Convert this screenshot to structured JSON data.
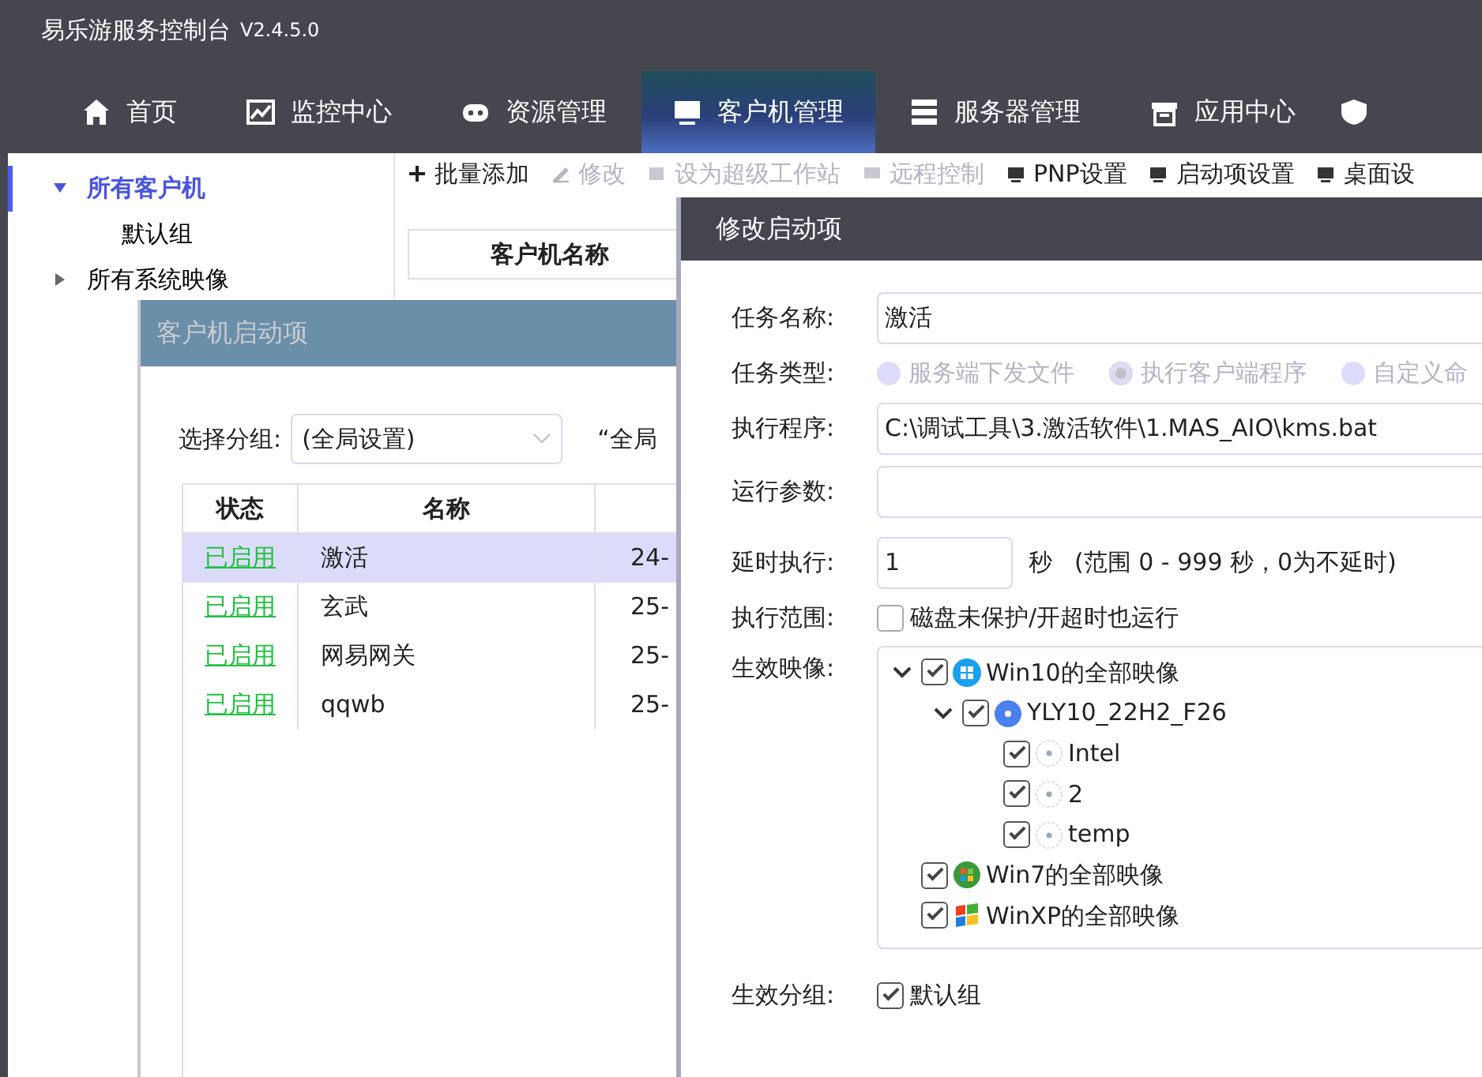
{
  "window": {
    "title": "易乐游服务控制台",
    "version": "V2.4.5.0"
  },
  "nav_tabs": [
    {
      "label": "首页",
      "selected": false
    },
    {
      "label": "监控中心",
      "selected": false
    },
    {
      "label": "资源管理",
      "selected": false
    },
    {
      "label": "客户机管理",
      "selected": true
    },
    {
      "label": "服务器管理",
      "selected": false
    },
    {
      "label": "应用中心",
      "selected": false
    },
    {
      "selected": false
    }
  ],
  "sidebar": {
    "items": [
      {
        "label": "所有客户机",
        "expanded": true,
        "selected": true,
        "children": [
          {
            "label": "默认组",
            "selected": false
          }
        ]
      },
      {
        "label": "所有系统映像",
        "expanded": false,
        "selected": false
      }
    ]
  },
  "toolbar": [
    {
      "label": "批量添加",
      "disabled": false
    },
    {
      "label": "修改",
      "disabled": true
    },
    {
      "label": "设为超级工作站",
      "disabled": true
    },
    {
      "label": "远程控制",
      "disabled": true
    },
    {
      "label": "PNP设置",
      "disabled": false
    },
    {
      "label": "启动项设置",
      "disabled": false
    },
    {
      "label": "桌面设",
      "disabled": false
    }
  ],
  "client_table": {
    "columns": [
      "客户机名称"
    ]
  },
  "startup_dialog": {
    "title": "客户机启动项",
    "group_label": "选择分组:",
    "group_value": "(全局设置)",
    "note": "“全局",
    "columns": [
      "状态",
      "名称"
    ],
    "rows": [
      {
        "status": "已启用",
        "name": "激活",
        "column_3": "24-",
        "selected": true
      },
      {
        "status": "已启用",
        "name": "玄武",
        "column_3": "25-",
        "selected": false
      },
      {
        "status": "已启用",
        "name": "网易网关",
        "column_3": "25-",
        "selected": false
      },
      {
        "status": "已启用",
        "name": "qqwb",
        "column_3": "25-",
        "selected": false
      }
    ]
  },
  "edit_dialog": {
    "title": "修改启动项",
    "task_name": {
      "label": "任务名称:",
      "value": "激活"
    },
    "task_type": {
      "label": "任务类型:",
      "options": [
        {
          "label": "服务端下发文件",
          "selected": false
        },
        {
          "label": "执行客户端程序",
          "selected": true
        },
        {
          "label": "自定义命",
          "selected": false
        }
      ]
    },
    "program": {
      "label": "执行程序:",
      "value": "C:\\调试工具\\3.激活软件\\1.MAS_AIO\\kms.bat"
    },
    "args": {
      "label": "运行参数:"
    },
    "delay": {
      "label": "延时执行:",
      "value": "1",
      "unit": "秒",
      "hint": "(范围 0 - 999 秒，0为不延时)"
    },
    "scope": {
      "label": "执行范围:",
      "option": "磁盘未保护/开超时也运行",
      "checked": false
    },
    "images": {
      "label": "生效映像:",
      "tree": [
        {
          "label": "Win10的全部映像",
          "kind": "win10",
          "checked": true,
          "expanded": true,
          "children": [
            {
              "label": "YLY10_22H2_F26",
              "kind": "disc",
              "checked": true,
              "expanded": true,
              "children": [
                {
                  "label": "Intel",
                  "kind": "dot",
                  "checked": true
                },
                {
                  "label": "2",
                  "kind": "dot",
                  "checked": true
                },
                {
                  "label": "temp",
                  "kind": "dot",
                  "checked": true
                }
              ]
            }
          ]
        },
        {
          "label": "Win7的全部映像",
          "kind": "win7",
          "checked": true
        },
        {
          "label": "WinXP的全部映像",
          "kind": "winxp",
          "checked": true
        }
      ]
    },
    "groups": {
      "label": "生效分组:",
      "options": [
        {
          "label": "默认组",
          "checked": true
        }
      ]
    }
  }
}
